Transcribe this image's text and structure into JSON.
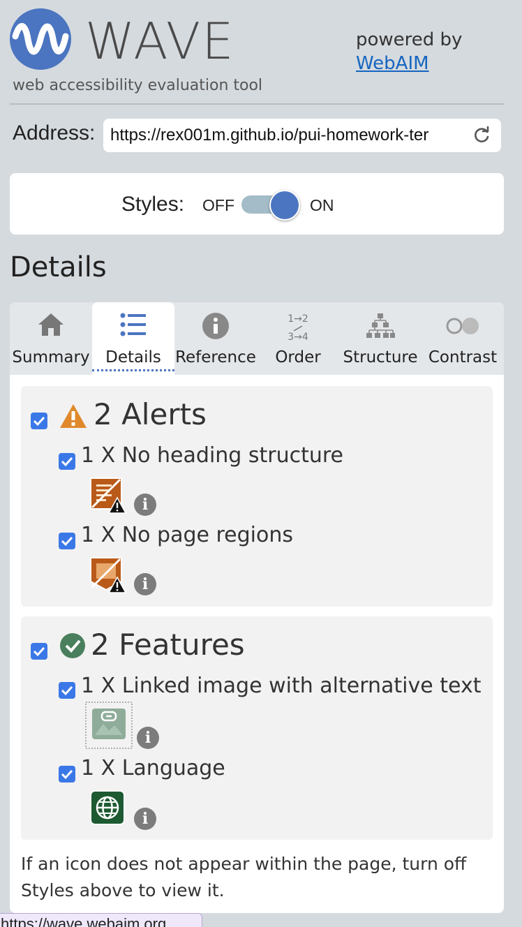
{
  "header": {
    "title": "WAVE",
    "tagline": "web accessibility evaluation tool",
    "powered_by": "powered by",
    "webaim_link": "WebAIM",
    "brand_color": "#4b75c0"
  },
  "address": {
    "label": "Address:",
    "value": "https://rex001m.github.io/pui-homework-ter"
  },
  "styles": {
    "label": "Styles:",
    "off": "OFF",
    "on": "ON",
    "state": "on"
  },
  "details_heading": "Details",
  "tabs": [
    {
      "label": "Summary",
      "icon": "home-icon"
    },
    {
      "label": "Details",
      "icon": "list-icon",
      "active": true
    },
    {
      "label": "Reference",
      "icon": "info-icon"
    },
    {
      "label": "Order",
      "icon": "order-icon",
      "glyph_top": "1→2",
      "glyph_bottom": "3→4"
    },
    {
      "label": "Structure",
      "icon": "structure-icon"
    },
    {
      "label": "Contrast",
      "icon": "contrast-icon"
    }
  ],
  "alerts": {
    "title": "2 Alerts",
    "color": "#e0892b",
    "items": [
      {
        "label": "1 X No heading structure",
        "icon": "no-heading-icon"
      },
      {
        "label": "1 X No page regions",
        "icon": "no-regions-icon"
      }
    ]
  },
  "features": {
    "title": "2 Features",
    "color": "#4a7f5e",
    "items": [
      {
        "label": "1 X Linked image with alternative text",
        "icon": "linked-image-icon"
      },
      {
        "label": "1 X Language",
        "icon": "language-icon"
      }
    ]
  },
  "footer_note": "If an icon does not appear within the page, turn off Styles above to view it.",
  "status_url": "https://wave.webaim.org"
}
